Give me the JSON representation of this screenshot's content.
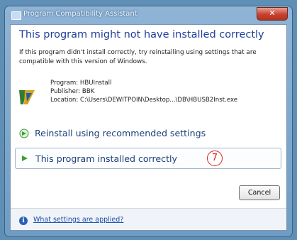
{
  "window": {
    "title": "Program Compatibility Assistant",
    "close_glyph": "✕"
  },
  "main": {
    "heading": "This program might not have installed correctly",
    "description": "If this program didn't install correctly, try reinstalling using settings that are compatible with this version of Windows.",
    "program": {
      "name_line": "Program: HBUInstall",
      "publisher_line": "Publisher: BBK",
      "location_line": "Location: C:\\Users\\DEWITPOIN\\Desktop...\\DB\\HBUSB2Inst.exe"
    },
    "options": [
      {
        "label": "Reinstall using recommended settings",
        "icon": "green-arrow-icon"
      },
      {
        "label": "This program installed correctly",
        "icon": "green-arrow-icon"
      }
    ],
    "step_badge": "7",
    "cancel_label": "Cancel"
  },
  "footer": {
    "info_glyph": "i",
    "link": "What settings are applied?"
  },
  "colors": {
    "heading": "#1e3f9a",
    "option_arrow": "#3f9c35",
    "badge": "#d8221a",
    "link": "#1a4fb0"
  }
}
